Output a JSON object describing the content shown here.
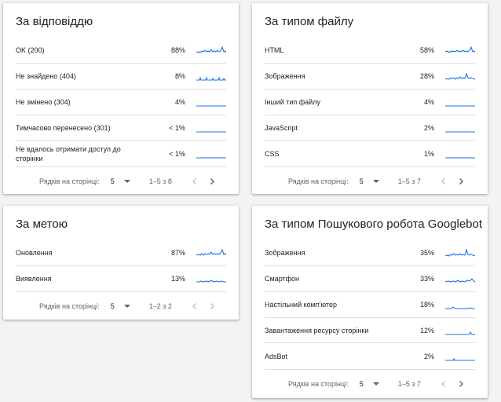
{
  "colors": {
    "accent": "#1a73e8",
    "divider": "#e0e0e0",
    "muted": "#bdc1c6"
  },
  "pagination": {
    "rows_per_page_label": "Рядків на сторінці:",
    "rows_per_page_value": "5"
  },
  "cards": {
    "response": {
      "title": "За відповіддю",
      "range": "1–5 з 8",
      "rows": [
        {
          "name": "OK (200)",
          "pct": "88%"
        },
        {
          "name": "Не знайдено (404)",
          "pct": "8%"
        },
        {
          "name": "Не змінено (304)",
          "pct": "4%"
        },
        {
          "name": "Тимчасово перенесено (301)",
          "pct": "< 1%"
        },
        {
          "name": "Не вдалось отримати доступ до сторінки",
          "pct": "< 1%"
        }
      ]
    },
    "filetype": {
      "title": "За типом файлу",
      "range": "1–5 з 7",
      "rows": [
        {
          "name": "HTML",
          "pct": "58%"
        },
        {
          "name": "Зображення",
          "pct": "28%"
        },
        {
          "name": "Інший тип файлу",
          "pct": "4%"
        },
        {
          "name": "JavaScript",
          "pct": "2%"
        },
        {
          "name": "CSS",
          "pct": "1%"
        }
      ]
    },
    "purpose": {
      "title": "За метою",
      "range": "1–2 з 2",
      "rows": [
        {
          "name": "Оновлення",
          "pct": "87%"
        },
        {
          "name": "Виявлення",
          "pct": "13%"
        }
      ]
    },
    "googlebot": {
      "title": "За типом Пошукового робота Googlebot",
      "range": "1–5 з 7",
      "rows": [
        {
          "name": "Зображення",
          "pct": "35%"
        },
        {
          "name": "Смартфон",
          "pct": "33%"
        },
        {
          "name": "Настільний комп'ютер",
          "pct": "18%"
        },
        {
          "name": "Завантаження ресурсу сторінки",
          "pct": "12%"
        },
        {
          "name": "AdsBot",
          "pct": "2%"
        }
      ]
    }
  }
}
